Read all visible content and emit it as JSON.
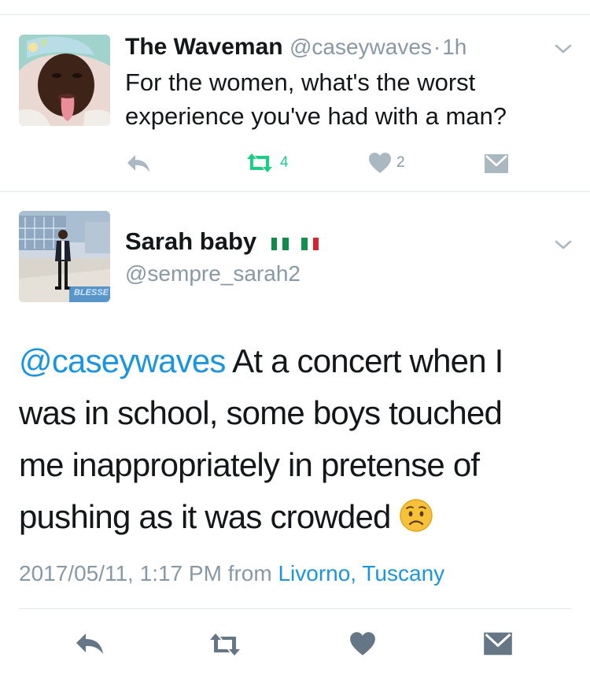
{
  "tweet1": {
    "name": "The Waveman",
    "handle": "@caseywaves",
    "separator": "·",
    "time": "1h",
    "text_line1": "For the women, what's the worst",
    "text_line2": "experience you've had with a man?",
    "retweet_count": "4",
    "like_count": "2"
  },
  "tweet2": {
    "name": "Sarah baby",
    "handle": "@sempre_sarah2",
    "avatar_caption": "BLESSED",
    "mention": "@caseywaves",
    "body_line1": "At a concert when I",
    "body_line2": "was in school, some boys touched",
    "body_line3": "me inappropriately in pretense of",
    "body_line4": "pushing as it was crowded",
    "timestamp": "2017/05/11, 1:17 PM",
    "from_label": "from",
    "location": "Livorno, Tuscany"
  },
  "colors": {
    "retweet_green": "#19cf86",
    "link_blue": "#1b95e0",
    "meta_gray": "#8899a6",
    "icon_slate": "#657786"
  },
  "icons": [
    "chevron-down-icon",
    "reply-icon",
    "retweet-icon",
    "heart-icon",
    "dm-envelope-icon",
    "flag-nigeria-icon",
    "flag-italy-icon",
    "worried-face-emoji"
  ]
}
